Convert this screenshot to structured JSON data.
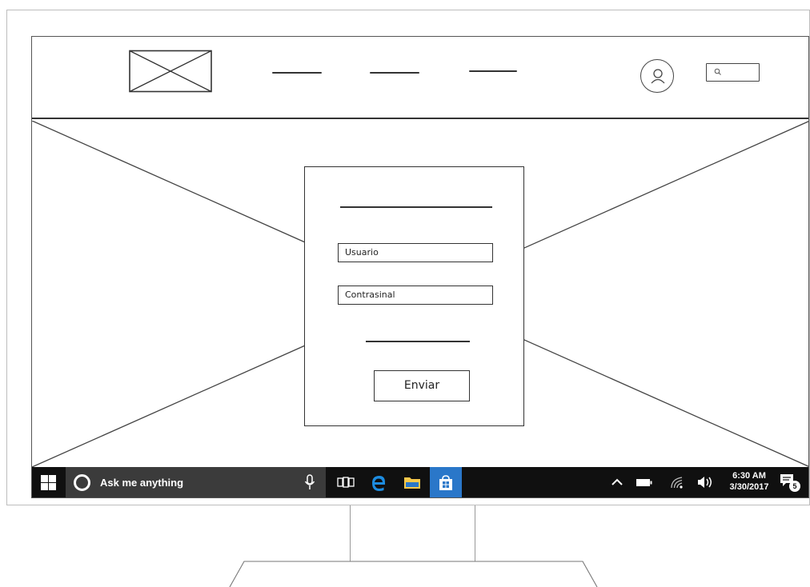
{
  "login": {
    "username_placeholder": "Usuario",
    "password_placeholder": "Contrasinal",
    "submit_label": "Enviar"
  },
  "taskbar": {
    "search_placeholder": "Ask me anything",
    "clock_time": "6:30 AM",
    "clock_date": "3/30/2017",
    "notification_count": "5",
    "apps": [
      "task-view",
      "edge",
      "file-explorer",
      "store"
    ],
    "tray_icons": [
      "chevron-up-icon",
      "battery-icon",
      "wifi-icon",
      "volume-icon"
    ]
  },
  "colors": {
    "taskbar_bg": "#101010",
    "search_bg": "#3b3b3b",
    "store_active": "#2a77c9",
    "edge_blue": "#1d8ce0",
    "folder_yellow": "#f7c84a",
    "sketch_stroke": "#333333"
  }
}
